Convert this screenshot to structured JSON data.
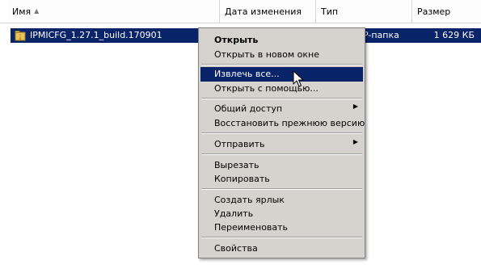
{
  "columns": {
    "name": "Имя",
    "date_modified": "Дата изменения",
    "type": "Тип",
    "size": "Размер"
  },
  "file": {
    "name": "IPMICFG_1.27.1_build.170901",
    "type": "P-папка",
    "size": "1 629 КБ",
    "icon": "zip-folder-icon"
  },
  "context_menu": {
    "open": "Открыть",
    "open_new_window": "Открыть в новом окне",
    "extract_all": "Извлечь все...",
    "open_with": "Открыть с помощью...",
    "sharing": "Общий доступ",
    "restore_previous": "Восстановить прежнюю версию",
    "send_to": "Отправить",
    "cut": "Вырезать",
    "copy": "Копировать",
    "create_shortcut": "Создать ярлык",
    "delete": "Удалить",
    "rename": "Переименовать",
    "properties": "Свойства"
  },
  "colors": {
    "selection": "#0a246a",
    "menu_background": "#d6d3ce"
  }
}
